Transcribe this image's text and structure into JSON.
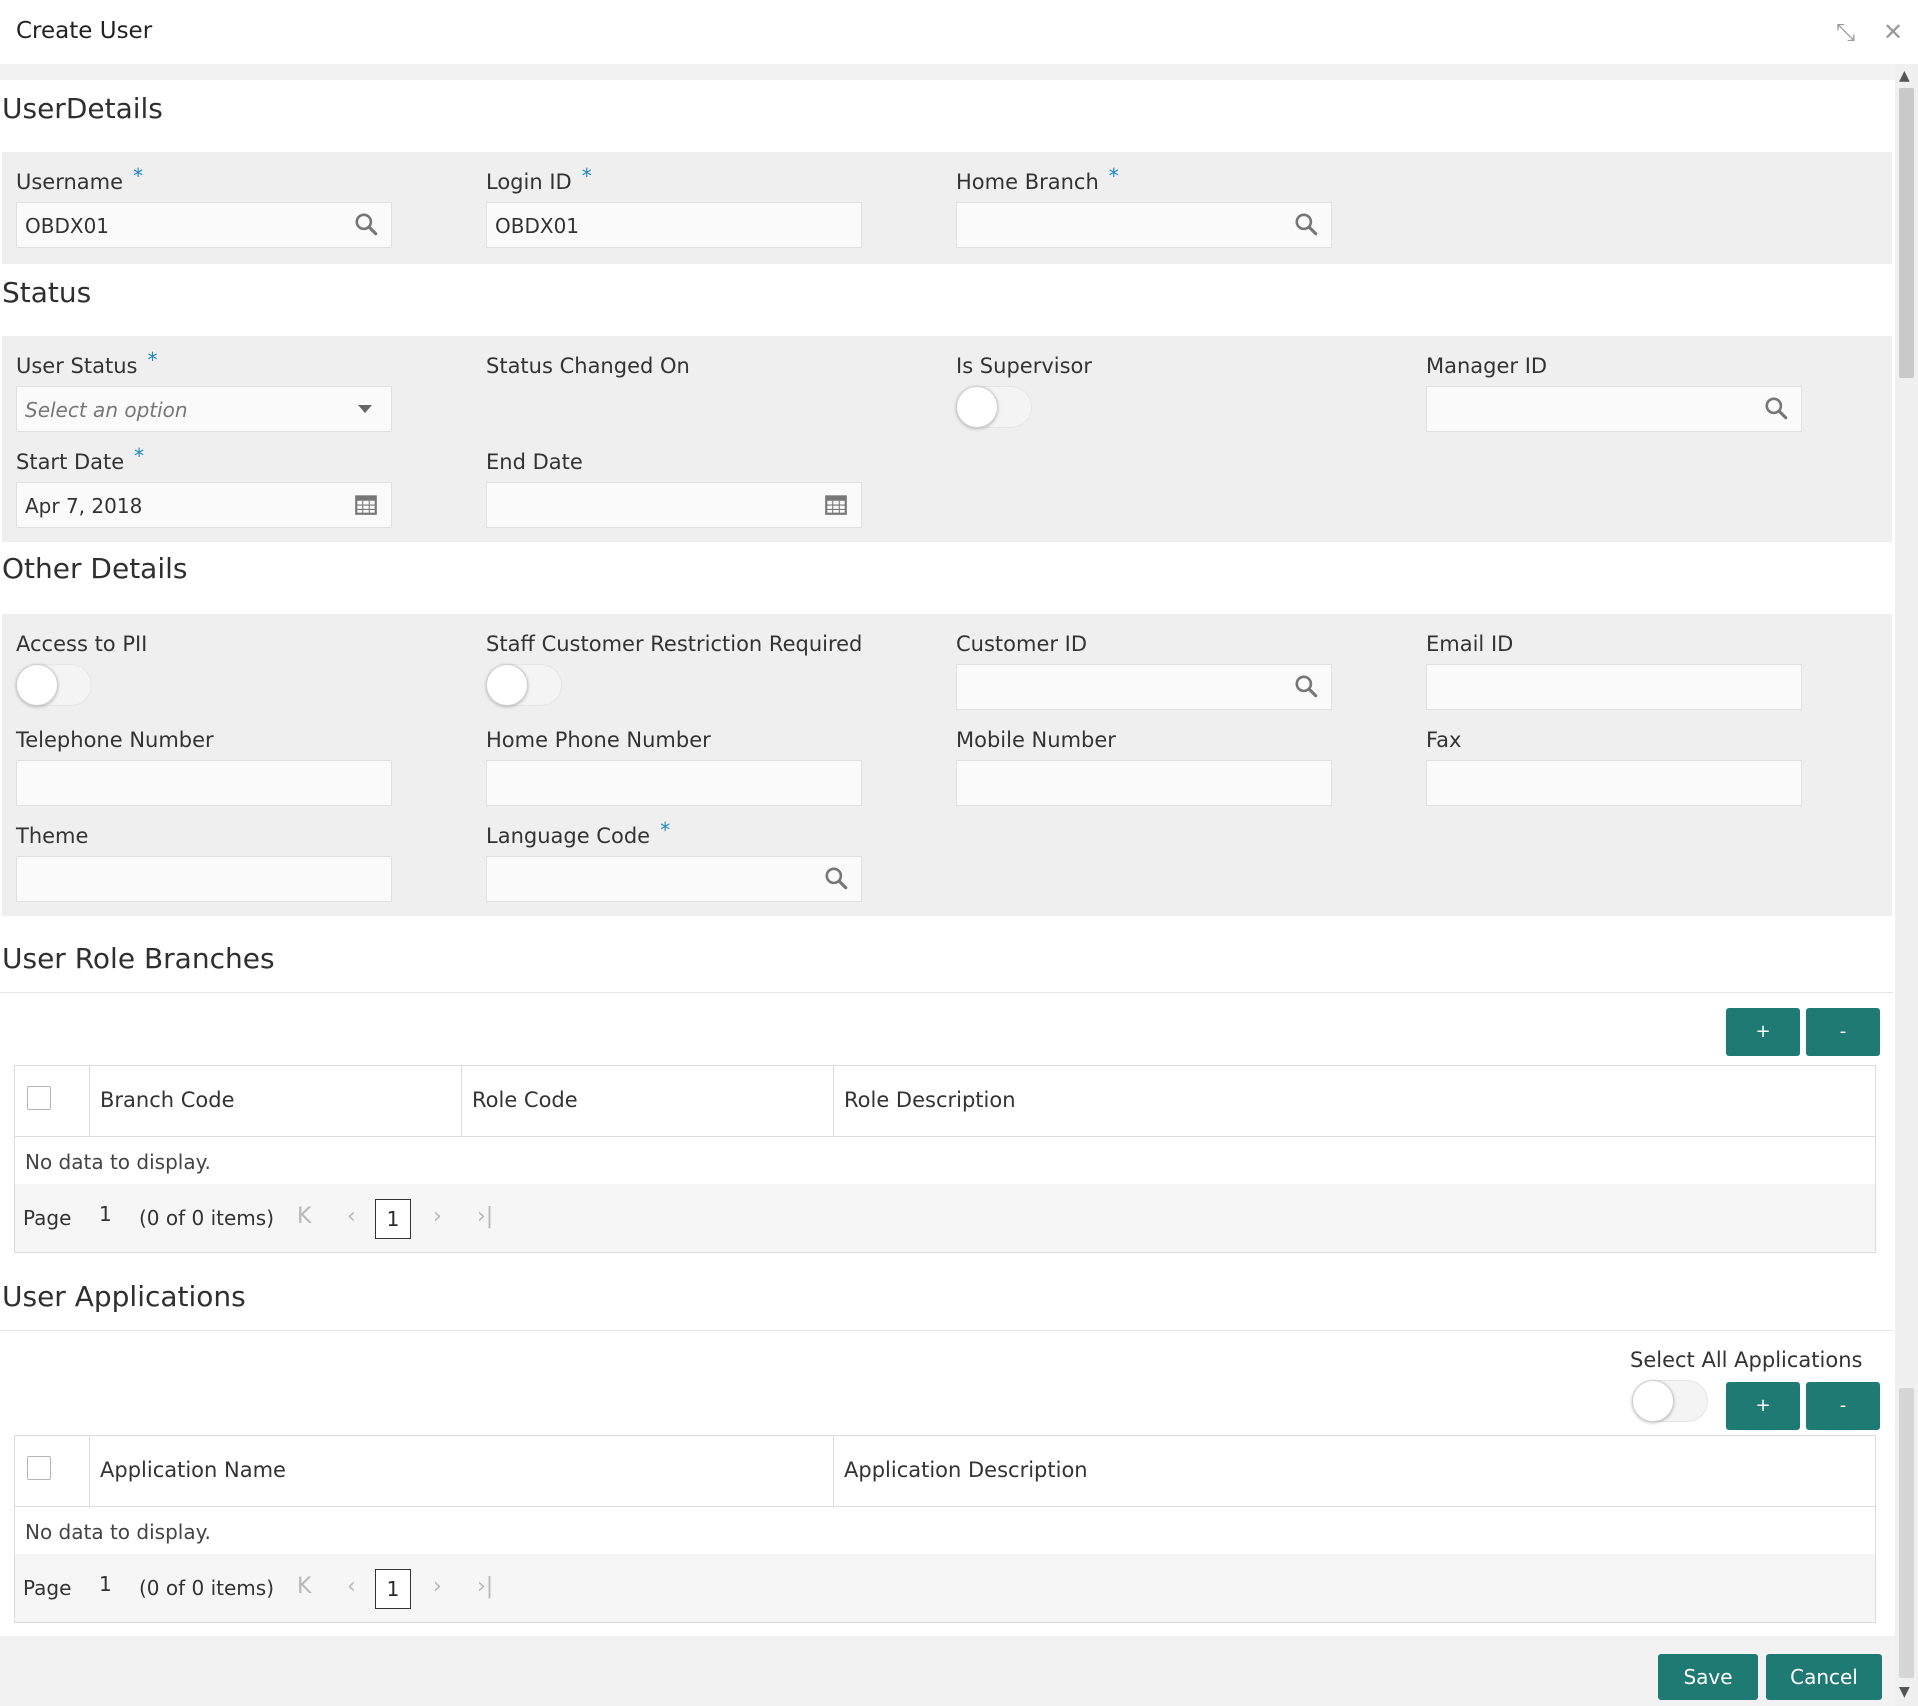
{
  "window": {
    "title": "Create User",
    "minimize_glyph": "⤡",
    "close_glyph": "✕"
  },
  "user_details": {
    "title": "UserDetails",
    "username": {
      "label": "Username",
      "value": "OBDX01",
      "required": "*"
    },
    "login_id": {
      "label": "Login ID",
      "value": "OBDX01",
      "required": "*"
    },
    "home_branch": {
      "label": "Home Branch",
      "value": "",
      "required": "*"
    }
  },
  "status": {
    "title": "Status",
    "user_status": {
      "label": "User Status",
      "placeholder": "Select an option",
      "required": "*"
    },
    "status_changed_on": {
      "label": "Status Changed On"
    },
    "is_supervisor": {
      "label": "Is Supervisor",
      "on": false
    },
    "manager_id": {
      "label": "Manager ID",
      "value": ""
    },
    "start_date": {
      "label": "Start Date",
      "value": "Apr 7, 2018",
      "required": "*"
    },
    "end_date": {
      "label": "End Date",
      "value": ""
    }
  },
  "other_details": {
    "title": "Other Details",
    "access_to_pii": {
      "label": "Access to PII",
      "on": false
    },
    "staff_restriction": {
      "label": "Staff Customer Restriction Required",
      "on": false
    },
    "customer_id": {
      "label": "Customer ID",
      "value": ""
    },
    "email_id": {
      "label": "Email ID",
      "value": ""
    },
    "telephone": {
      "label": "Telephone Number",
      "value": ""
    },
    "home_phone": {
      "label": "Home Phone Number",
      "value": ""
    },
    "mobile": {
      "label": "Mobile Number",
      "value": ""
    },
    "fax": {
      "label": "Fax",
      "value": ""
    },
    "theme": {
      "label": "Theme",
      "value": ""
    },
    "language_code": {
      "label": "Language Code",
      "value": "",
      "required": "*"
    }
  },
  "role_branches": {
    "title": "User Role Branches",
    "add_label": "+",
    "remove_label": "-",
    "columns": [
      "Branch Code",
      "Role Code",
      "Role Description"
    ],
    "empty_text": "No data to display.",
    "pager": {
      "page_label": "Page",
      "page_value": "1",
      "items_text": "(0 of 0 items)",
      "current": "1"
    }
  },
  "applications": {
    "title": "User Applications",
    "select_all_label": "Select All Applications",
    "select_all_on": false,
    "add_label": "+",
    "remove_label": "-",
    "columns": [
      "Application Name",
      "Application Description"
    ],
    "empty_text": "No data to display.",
    "pager": {
      "page_label": "Page",
      "page_value": "1",
      "items_text": "(0 of 0 items)",
      "current": "1"
    }
  },
  "footer": {
    "save_label": "Save",
    "cancel_label": "Cancel"
  },
  "pager_glyphs": {
    "first": "K",
    "prev": "‹",
    "next": "›",
    "last": "›|"
  },
  "colors": {
    "primary_button": "#1f7a74",
    "required_star": "#1e88c8",
    "panel_bg": "#efefef"
  }
}
